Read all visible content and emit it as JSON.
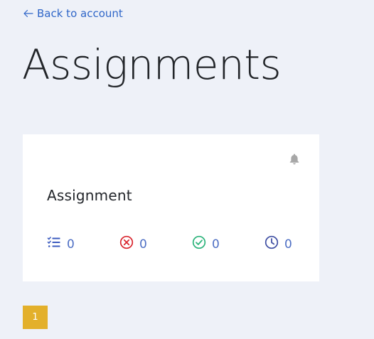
{
  "nav": {
    "back_label": "Back to account"
  },
  "page": {
    "title": "Assignments"
  },
  "assignments": [
    {
      "title": "Assignment",
      "stats": {
        "total": "0",
        "failed": "0",
        "passed": "0",
        "pending": "0"
      }
    }
  ],
  "pagination": {
    "current_page": "1"
  },
  "colors": {
    "background": "#eef1f8",
    "link": "#2f66c8",
    "total_icon": "#3b5bbf",
    "failed_icon": "#d9262f",
    "passed_icon": "#2bb37a",
    "pending_icon": "#3f4fa3",
    "page_active": "#e3b02b",
    "bell": "#a7a7a7"
  },
  "icons": {
    "back": "arrow-left-icon",
    "bell": "bell-icon",
    "total": "checklist-icon",
    "failed": "x-circle-icon",
    "passed": "check-circle-icon",
    "pending": "clock-icon"
  }
}
